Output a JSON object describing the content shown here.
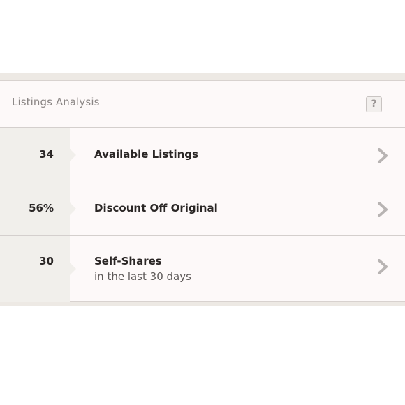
{
  "header": {
    "title": "Listings Analysis",
    "help_icon": "?"
  },
  "rows": [
    {
      "value": "34",
      "label": "Available Listings"
    },
    {
      "value": "56%",
      "label": "Discount Off Original"
    },
    {
      "value": "30",
      "label": "Self-Shares",
      "sublabel": "in the last 30 days"
    }
  ],
  "icons": {
    "row_arrow": "chevron-right-icon",
    "help": "question-mark-icon"
  },
  "colors": {
    "value_column": "#f1efeb",
    "panel_background": "#fdf9f9",
    "chevron": "#b8b4b3"
  }
}
